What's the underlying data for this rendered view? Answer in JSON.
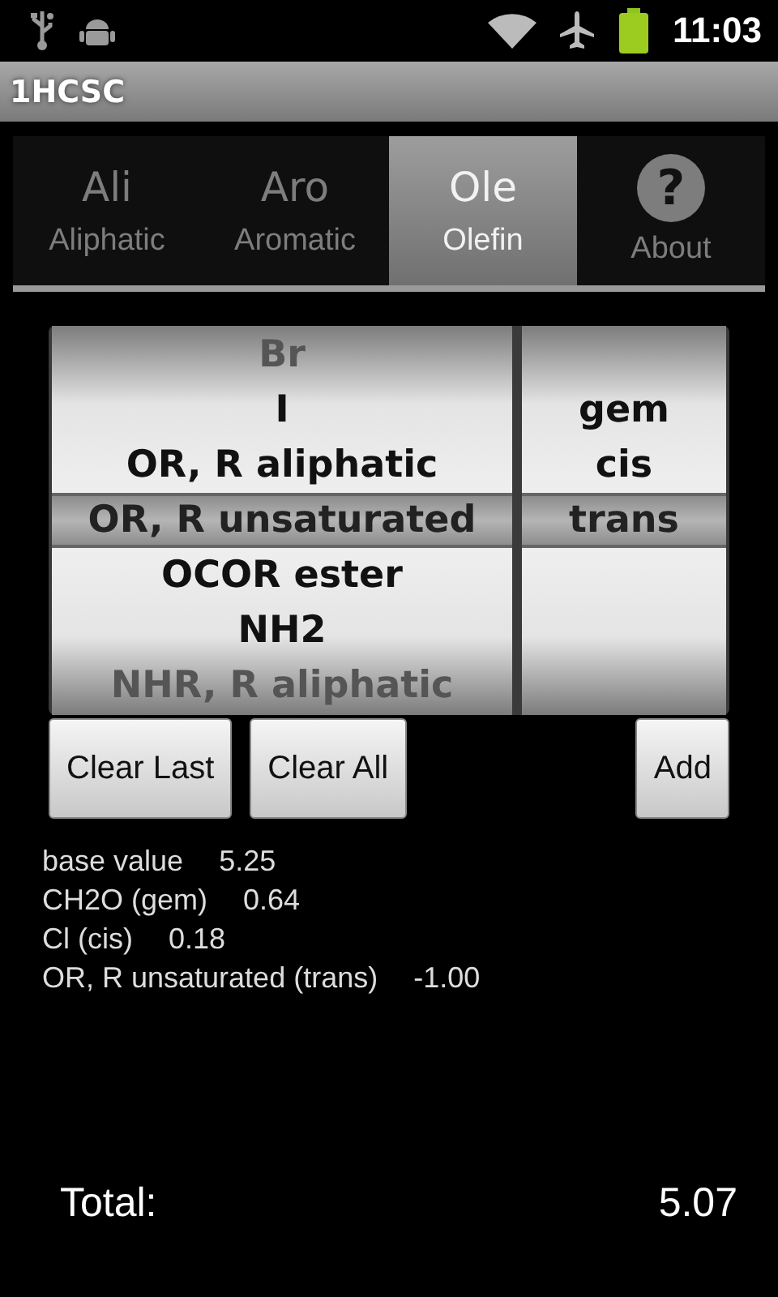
{
  "status_bar": {
    "time": "11:03"
  },
  "window": {
    "title": "1HCSC"
  },
  "tabs": [
    {
      "kind": "text",
      "icon": "Ali",
      "label": "Aliphatic",
      "selected": false
    },
    {
      "kind": "text",
      "icon": "Aro",
      "label": "Aromatic",
      "selected": false
    },
    {
      "kind": "text",
      "icon": "Ole",
      "label": "Olefin",
      "selected": true
    },
    {
      "kind": "help",
      "icon": "?",
      "label": "About",
      "selected": false
    }
  ],
  "picker": {
    "wheels": [
      {
        "items": [
          {
            "text": "Br",
            "selected": false
          },
          {
            "text": "I",
            "selected": false
          },
          {
            "text": "OR, R aliphatic",
            "selected": false
          },
          {
            "text": "OR, R unsaturated",
            "selected": true
          },
          {
            "text": "OCOR ester",
            "selected": false
          },
          {
            "text": "NH2",
            "selected": false
          },
          {
            "text": "NHR, R aliphatic",
            "selected": false
          }
        ]
      },
      {
        "items": [
          {
            "text": "gem",
            "selected": false
          },
          {
            "text": "cis",
            "selected": false
          },
          {
            "text": "trans",
            "selected": true
          }
        ]
      }
    ]
  },
  "buttons": [
    {
      "label": "Clear Last",
      "kind": "left"
    },
    {
      "label": "Clear All",
      "kind": "left"
    },
    {
      "label": "Add",
      "kind": "right"
    }
  ],
  "results": [
    {
      "label": "base value",
      "value": "5.25"
    },
    {
      "label": "CH2O (gem)",
      "value": "0.64"
    },
    {
      "label": "Cl (cis)",
      "value": "0.18"
    },
    {
      "label": "OR, R unsaturated (trans)",
      "value": "-1.00"
    }
  ],
  "total": {
    "label": "Total:",
    "value": "5.07"
  }
}
